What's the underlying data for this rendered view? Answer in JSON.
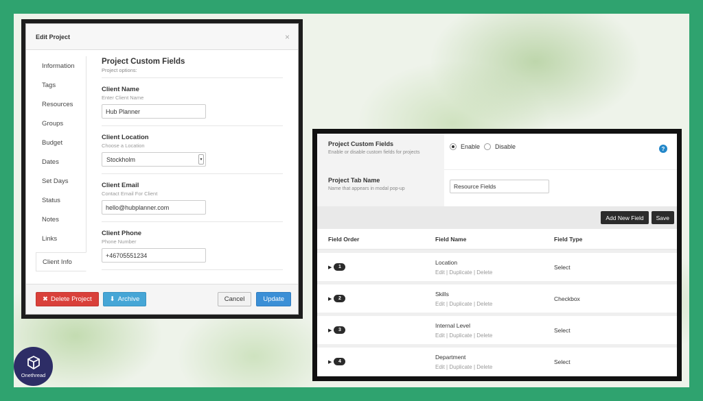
{
  "edit_project": {
    "title": "Edit Project",
    "close_icon": "×",
    "sidebar_items": [
      "Information",
      "Tags",
      "Resources",
      "Groups",
      "Budget",
      "Dates",
      "Set Days",
      "Status",
      "Notes",
      "Links",
      "Client Info"
    ],
    "active_item": "Client Info",
    "section_title": "Project Custom Fields",
    "section_subtitle": "Project options:",
    "fields": {
      "client_name": {
        "label": "Client Name",
        "help": "Enter Client Name",
        "value": "Hub Planner"
      },
      "client_location": {
        "label": "Client Location",
        "help": "Choose a Location",
        "value": "Stockholm"
      },
      "client_email": {
        "label": "Client Email",
        "help": "Contact Email For Client",
        "value": "hello@hubplanner.com"
      },
      "client_phone": {
        "label": "Client Phone",
        "help": "Phone Number",
        "value": "+46705551234"
      }
    },
    "buttons": {
      "delete": "Delete Project",
      "archive": "Archive",
      "cancel": "Cancel",
      "update": "Update"
    }
  },
  "custom_fields_settings": {
    "custom_fields": {
      "label": "Project Custom Fields",
      "help": "Enable or disable custom fields for projects",
      "enable": "Enable",
      "disable": "Disable",
      "selected": "Enable"
    },
    "tab_name": {
      "label": "Project Tab Name",
      "help": "Name that appears in modal pop-up",
      "value": "Resource Fields"
    },
    "toolbar": {
      "add_field": "Add New Field",
      "save": "Save"
    },
    "table": {
      "headers": [
        "Field Order",
        "Field Name",
        "Field Type"
      ],
      "actions": {
        "edit": "Edit",
        "duplicate": "Duplicate",
        "delete": "Delete",
        "separator": "|"
      },
      "rows": [
        {
          "order": "1",
          "name": "Location",
          "type": "Select"
        },
        {
          "order": "2",
          "name": "Skills",
          "type": "Checkbox"
        },
        {
          "order": "3",
          "name": "Internal Level",
          "type": "Select"
        },
        {
          "order": "4",
          "name": "Department",
          "type": "Select"
        }
      ]
    }
  },
  "logo": {
    "text": "Onethread"
  },
  "colors": {
    "background_green": "#2fa36f",
    "danger": "#d9403a",
    "info": "#46a6d6",
    "primary": "#3b8fd6",
    "help_icon": "#2387c9",
    "logo_bg": "#2d2d66"
  }
}
